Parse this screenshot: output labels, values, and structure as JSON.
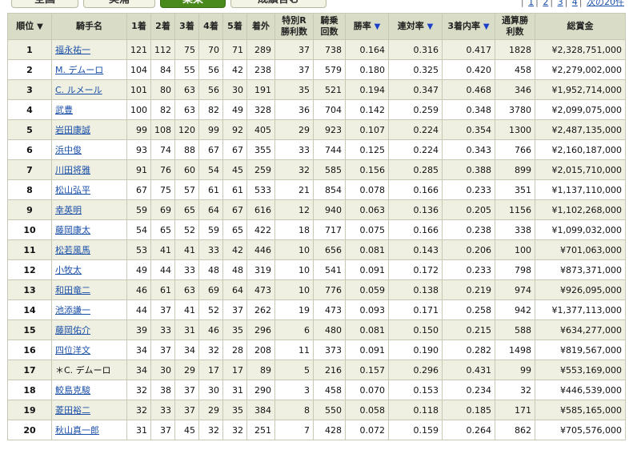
{
  "tabs": [
    {
      "label": "全国"
    },
    {
      "label": "美浦"
    },
    {
      "label": "栗東"
    },
    {
      "label": "成績含む"
    }
  ],
  "pager": {
    "pages": [
      "1",
      "2",
      "3",
      "4"
    ],
    "next": "次の20件"
  },
  "icons": {
    "sort_active": "▼",
    "sort_asc": "▼"
  },
  "colors": {
    "header_bg": "#d9dcc6",
    "odd_row": "#f0f0e2",
    "link": "#1a4fa8",
    "active_tab": "#4a8a1c"
  },
  "headers": {
    "rank": "順位",
    "jockey": "騎手名",
    "first": "1着",
    "second": "2着",
    "third": "3着",
    "fourth": "4着",
    "fifth": "5着",
    "out": "着外",
    "special": "特別R勝利数",
    "rides": "騎乗回数",
    "win_rate": "勝率",
    "place_rate": "連対率",
    "show_rate": "3着内率",
    "total_wins": "通算勝利数",
    "prize": "総賞金"
  },
  "rows": [
    {
      "rank": "1",
      "name": "福永祐一",
      "link": true,
      "c1": "121",
      "c2": "112",
      "c3": "75",
      "c4": "70",
      "c5": "71",
      "out": "289",
      "sp": "37",
      "rides": "738",
      "wr": "0.164",
      "pr": "0.316",
      "sr": "0.417",
      "tw": "1828",
      "prize": "¥2,328,751,000"
    },
    {
      "rank": "2",
      "name": "M. デムーロ",
      "link": true,
      "c1": "104",
      "c2": "84",
      "c3": "55",
      "c4": "56",
      "c5": "42",
      "out": "238",
      "sp": "37",
      "rides": "579",
      "wr": "0.180",
      "pr": "0.325",
      "sr": "0.420",
      "tw": "458",
      "prize": "¥2,279,002,000"
    },
    {
      "rank": "3",
      "name": "C. ルメール",
      "link": true,
      "c1": "101",
      "c2": "80",
      "c3": "63",
      "c4": "56",
      "c5": "30",
      "out": "191",
      "sp": "35",
      "rides": "521",
      "wr": "0.194",
      "pr": "0.347",
      "sr": "0.468",
      "tw": "346",
      "prize": "¥1,952,714,000"
    },
    {
      "rank": "4",
      "name": "武豊",
      "link": true,
      "c1": "100",
      "c2": "82",
      "c3": "63",
      "c4": "82",
      "c5": "49",
      "out": "328",
      "sp": "36",
      "rides": "704",
      "wr": "0.142",
      "pr": "0.259",
      "sr": "0.348",
      "tw": "3780",
      "prize": "¥2,099,075,000"
    },
    {
      "rank": "5",
      "name": "岩田康誠",
      "link": true,
      "c1": "99",
      "c2": "108",
      "c3": "120",
      "c4": "99",
      "c5": "92",
      "out": "405",
      "sp": "29",
      "rides": "923",
      "wr": "0.107",
      "pr": "0.224",
      "sr": "0.354",
      "tw": "1300",
      "prize": "¥2,487,135,000"
    },
    {
      "rank": "6",
      "name": "浜中俊",
      "link": true,
      "c1": "93",
      "c2": "74",
      "c3": "88",
      "c4": "67",
      "c5": "67",
      "out": "355",
      "sp": "33",
      "rides": "744",
      "wr": "0.125",
      "pr": "0.224",
      "sr": "0.343",
      "tw": "766",
      "prize": "¥2,160,187,000"
    },
    {
      "rank": "7",
      "name": "川田将雅",
      "link": true,
      "c1": "91",
      "c2": "76",
      "c3": "60",
      "c4": "54",
      "c5": "45",
      "out": "259",
      "sp": "32",
      "rides": "585",
      "wr": "0.156",
      "pr": "0.285",
      "sr": "0.388",
      "tw": "899",
      "prize": "¥2,015,710,000"
    },
    {
      "rank": "8",
      "name": "松山弘平",
      "link": true,
      "c1": "67",
      "c2": "75",
      "c3": "57",
      "c4": "61",
      "c5": "61",
      "out": "533",
      "sp": "21",
      "rides": "854",
      "wr": "0.078",
      "pr": "0.166",
      "sr": "0.233",
      "tw": "351",
      "prize": "¥1,137,110,000"
    },
    {
      "rank": "9",
      "name": "幸英明",
      "link": true,
      "c1": "59",
      "c2": "69",
      "c3": "65",
      "c4": "64",
      "c5": "67",
      "out": "616",
      "sp": "12",
      "rides": "940",
      "wr": "0.063",
      "pr": "0.136",
      "sr": "0.205",
      "tw": "1156",
      "prize": "¥1,102,268,000"
    },
    {
      "rank": "10",
      "name": "藤岡康太",
      "link": true,
      "c1": "54",
      "c2": "65",
      "c3": "52",
      "c4": "59",
      "c5": "65",
      "out": "422",
      "sp": "18",
      "rides": "717",
      "wr": "0.075",
      "pr": "0.166",
      "sr": "0.238",
      "tw": "338",
      "prize": "¥1,099,032,000"
    },
    {
      "rank": "11",
      "name": "松若風馬",
      "link": true,
      "c1": "53",
      "c2": "41",
      "c3": "41",
      "c4": "33",
      "c5": "42",
      "out": "446",
      "sp": "10",
      "rides": "656",
      "wr": "0.081",
      "pr": "0.143",
      "sr": "0.206",
      "tw": "100",
      "prize": "¥701,063,000"
    },
    {
      "rank": "12",
      "name": "小牧太",
      "link": true,
      "c1": "49",
      "c2": "44",
      "c3": "33",
      "c4": "48",
      "c5": "48",
      "out": "319",
      "sp": "10",
      "rides": "541",
      "wr": "0.091",
      "pr": "0.172",
      "sr": "0.233",
      "tw": "798",
      "prize": "¥873,371,000"
    },
    {
      "rank": "13",
      "name": "和田竜二",
      "link": true,
      "c1": "46",
      "c2": "61",
      "c3": "63",
      "c4": "69",
      "c5": "64",
      "out": "473",
      "sp": "10",
      "rides": "776",
      "wr": "0.059",
      "pr": "0.138",
      "sr": "0.219",
      "tw": "974",
      "prize": "¥926,095,000"
    },
    {
      "rank": "14",
      "name": "池添謙一",
      "link": true,
      "c1": "44",
      "c2": "37",
      "c3": "41",
      "c4": "52",
      "c5": "37",
      "out": "262",
      "sp": "19",
      "rides": "473",
      "wr": "0.093",
      "pr": "0.171",
      "sr": "0.258",
      "tw": "942",
      "prize": "¥1,377,113,000"
    },
    {
      "rank": "15",
      "name": "藤岡佑介",
      "link": true,
      "c1": "39",
      "c2": "33",
      "c3": "31",
      "c4": "46",
      "c5": "35",
      "out": "296",
      "sp": "6",
      "rides": "480",
      "wr": "0.081",
      "pr": "0.150",
      "sr": "0.215",
      "tw": "588",
      "prize": "¥634,277,000"
    },
    {
      "rank": "16",
      "name": "四位洋文",
      "link": true,
      "c1": "34",
      "c2": "37",
      "c3": "34",
      "c4": "32",
      "c5": "28",
      "out": "208",
      "sp": "11",
      "rides": "373",
      "wr": "0.091",
      "pr": "0.190",
      "sr": "0.282",
      "tw": "1498",
      "prize": "¥819,567,000"
    },
    {
      "rank": "17",
      "name": "＊C. デムーロ",
      "link": false,
      "c1": "34",
      "c2": "30",
      "c3": "29",
      "c4": "17",
      "c5": "17",
      "out": "89",
      "sp": "5",
      "rides": "216",
      "wr": "0.157",
      "pr": "0.296",
      "sr": "0.431",
      "tw": "99",
      "prize": "¥553,169,000"
    },
    {
      "rank": "18",
      "name": "鮫島克駿",
      "link": true,
      "c1": "32",
      "c2": "38",
      "c3": "37",
      "c4": "30",
      "c5": "31",
      "out": "290",
      "sp": "3",
      "rides": "458",
      "wr": "0.070",
      "pr": "0.153",
      "sr": "0.234",
      "tw": "32",
      "prize": "¥446,539,000"
    },
    {
      "rank": "19",
      "name": "菱田裕二",
      "link": true,
      "c1": "32",
      "c2": "33",
      "c3": "37",
      "c4": "29",
      "c5": "35",
      "out": "384",
      "sp": "8",
      "rides": "550",
      "wr": "0.058",
      "pr": "0.118",
      "sr": "0.185",
      "tw": "171",
      "prize": "¥585,165,000"
    },
    {
      "rank": "20",
      "name": "秋山真一郎",
      "link": true,
      "c1": "31",
      "c2": "37",
      "c3": "45",
      "c4": "32",
      "c5": "32",
      "out": "251",
      "sp": "7",
      "rides": "428",
      "wr": "0.072",
      "pr": "0.159",
      "sr": "0.264",
      "tw": "862",
      "prize": "¥705,576,000"
    }
  ]
}
